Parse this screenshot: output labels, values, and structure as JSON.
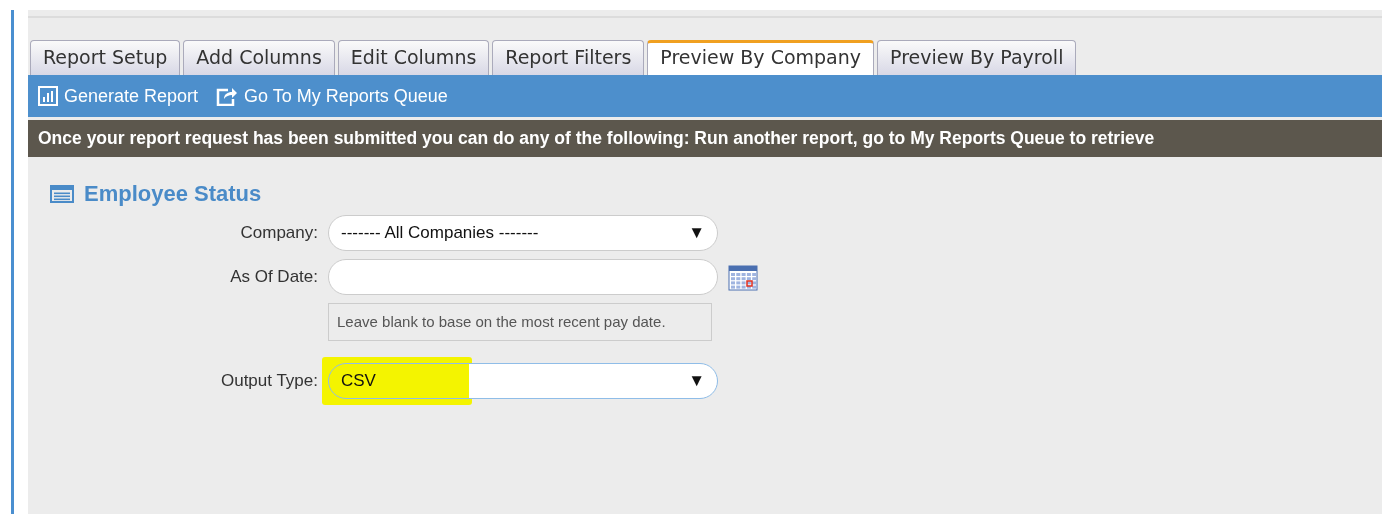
{
  "tabs": [
    {
      "label": "Report Setup",
      "selected": false
    },
    {
      "label": "Add Columns",
      "selected": false
    },
    {
      "label": "Edit Columns",
      "selected": false
    },
    {
      "label": "Report Filters",
      "selected": false
    },
    {
      "label": "Preview By Company",
      "selected": true
    },
    {
      "label": "Preview By Payroll",
      "selected": false
    }
  ],
  "toolbar": [
    {
      "kind": "chart",
      "label": "Generate Report"
    },
    {
      "kind": "export",
      "label": "Go To My Reports Queue"
    }
  ],
  "banner": "Once your report request has been submitted you can do any of the following: Run another report, go to My Reports Queue to retrieve",
  "section": {
    "title": "Employee Status"
  },
  "fields": [
    {
      "kind": "select",
      "label": "Company:",
      "value": "------- All Companies -------",
      "arrow": "▼",
      "highlighted": false
    },
    {
      "kind": "date",
      "label": "As Of Date:",
      "hint": "Leave blank to base on the most recent pay date."
    },
    {
      "kind": "select",
      "label": "Output Type:",
      "value": "CSV",
      "arrow": "▼",
      "highlighted": true
    }
  ]
}
